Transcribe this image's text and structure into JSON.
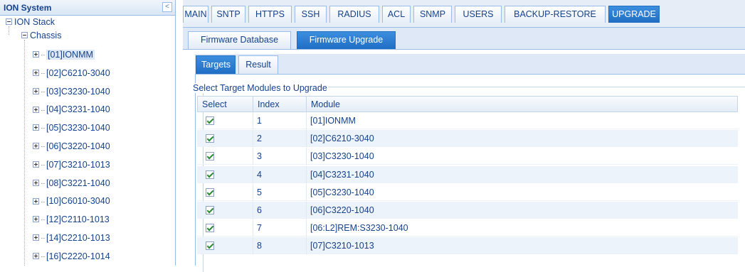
{
  "left_panel": {
    "title": "ION System",
    "collapse_glyph": "<",
    "tree": {
      "root": "ION Stack",
      "chassis": "Chassis",
      "modules": [
        "[01]IONMM",
        "[02]C6210-3040",
        "[03]C3230-1040",
        "[04]C3231-1040",
        "[05]C3230-1040",
        "[06]C3220-1040",
        "[07]C3210-1013",
        "[08]C3221-1040",
        "[10]C6010-3040",
        "[12]C2110-1013",
        "[14]C2210-1013",
        "[16]C2220-1014"
      ],
      "selected": "[01]IONMM"
    }
  },
  "main_tabs": [
    "MAIN",
    "SNTP",
    "HTTPS",
    "SSH",
    "RADIUS",
    "ACL",
    "SNMP",
    "USERS",
    "BACKUP-RESTORE",
    "UPGRADE"
  ],
  "main_active": "UPGRADE",
  "sub_tabs": [
    "Firmware Database",
    "Firmware Upgrade"
  ],
  "sub_active": "Firmware Upgrade",
  "inner_tabs": [
    "Targets",
    "Result"
  ],
  "inner_active": "Targets",
  "legend": "Select Target Modules to Upgrade",
  "table": {
    "columns": [
      "Select",
      "Index",
      "Module"
    ],
    "rows": [
      {
        "checked": true,
        "index": "1",
        "module": "[01]IONMM"
      },
      {
        "checked": true,
        "index": "2",
        "module": "[02]C6210-3040"
      },
      {
        "checked": true,
        "index": "3",
        "module": "[03]C3230-1040"
      },
      {
        "checked": true,
        "index": "4",
        "module": "[04]C3231-1040"
      },
      {
        "checked": true,
        "index": "5",
        "module": "[05]C3230-1040"
      },
      {
        "checked": true,
        "index": "6",
        "module": "[06]C3220-1040"
      },
      {
        "checked": true,
        "index": "7",
        "module": "[06:L2]REM:S3230-1040"
      },
      {
        "checked": true,
        "index": "8",
        "module": "[07]C3210-1013"
      }
    ]
  },
  "colors": {
    "accent": "#1f6ec4",
    "border": "#99bbe8",
    "text": "#15428b",
    "alt_row": "#edf3fb"
  }
}
